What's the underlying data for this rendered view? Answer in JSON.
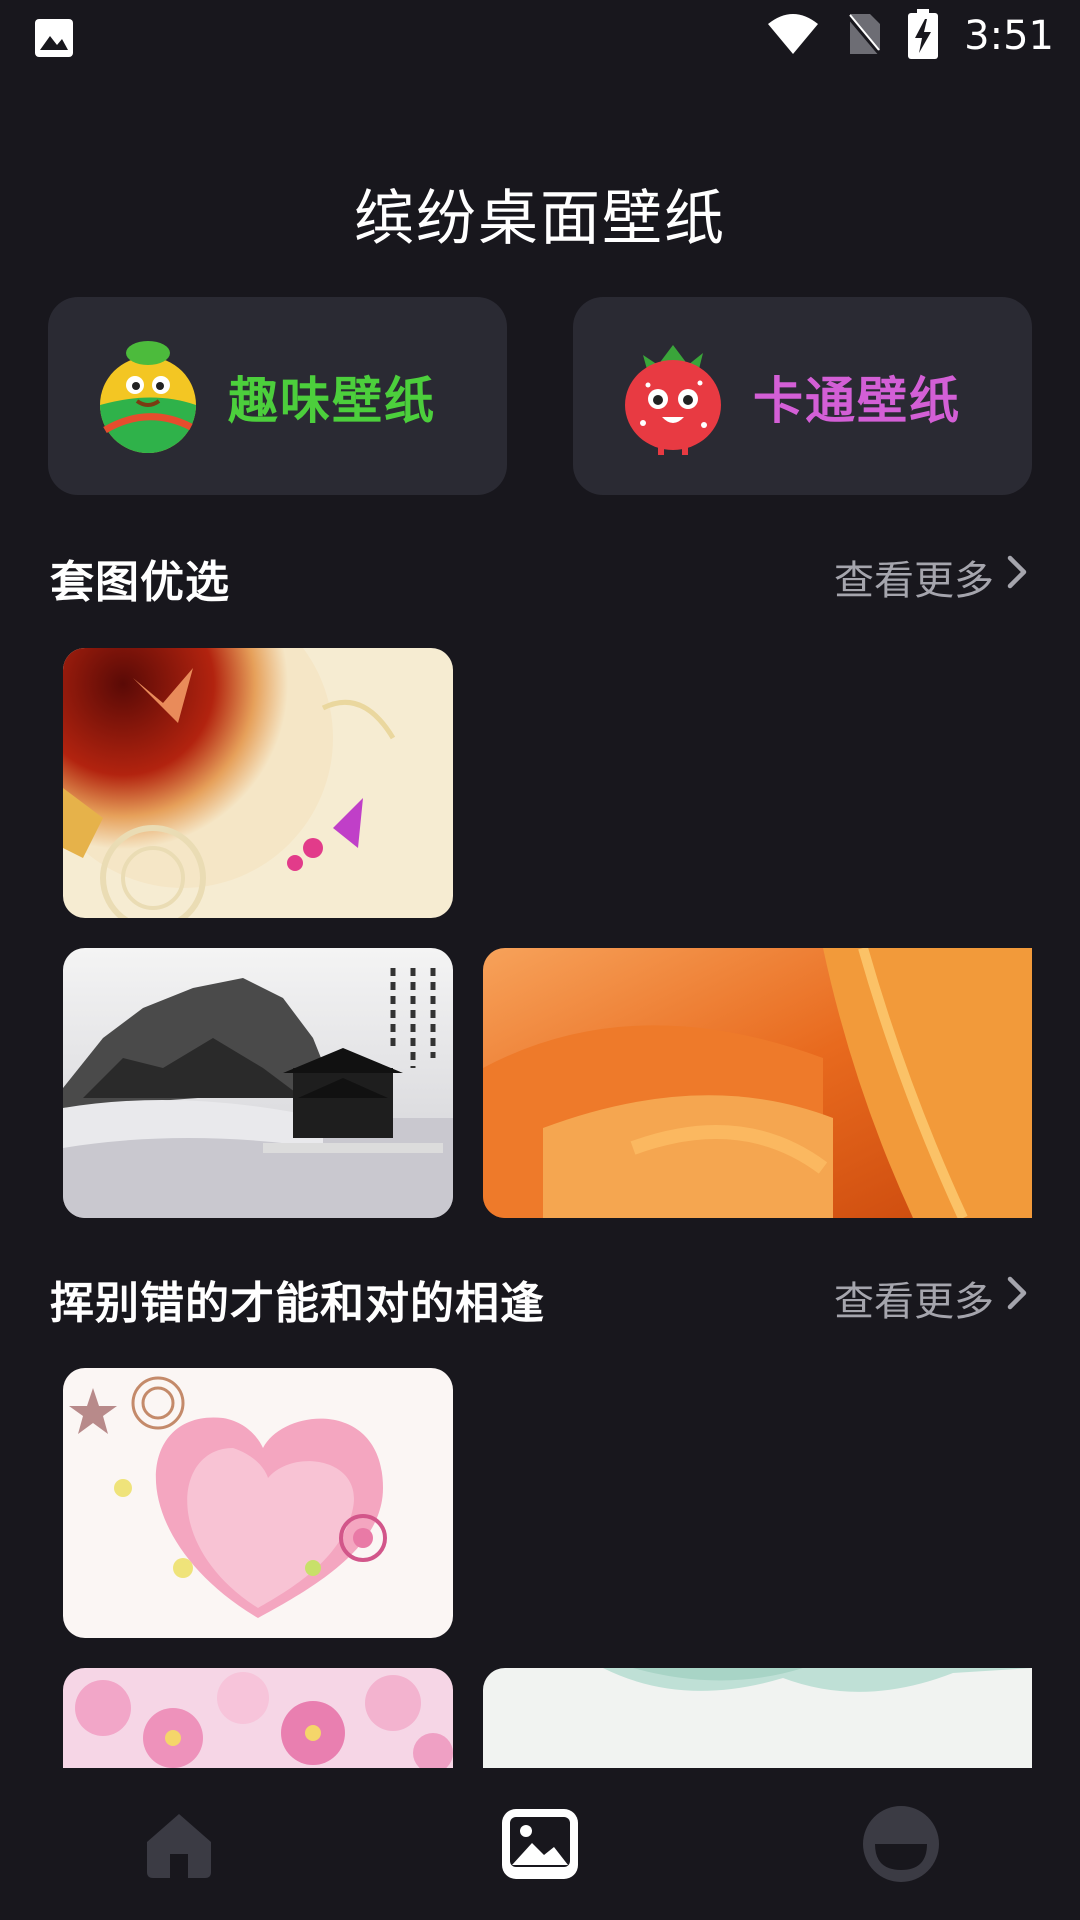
{
  "status_bar": {
    "time": "3:51",
    "icons": [
      "gallery-notification-icon",
      "wifi-icon",
      "no-sim-icon",
      "battery-charging-icon"
    ]
  },
  "header": {
    "title": "缤纷桌面壁纸"
  },
  "categories": [
    {
      "label": "趣味壁纸",
      "color": "#4ccf3c",
      "mascot": "green-ball-mascot-icon"
    },
    {
      "label": "卡通壁纸",
      "color": "#d35fd6",
      "mascot": "strawberry-mascot-icon"
    }
  ],
  "sections": [
    {
      "title": "套图优选",
      "more": "查看更多"
    },
    {
      "title": "挥别错的才能和对的相逢",
      "more": "查看更多"
    }
  ],
  "bottom_nav": {
    "items": [
      "home-icon",
      "wallpaper-icon",
      "profile-icon"
    ],
    "active": "wallpaper-icon"
  },
  "colors": {
    "background": "#18171d",
    "card": "#2a2a33",
    "muted_text": "#a5a5ad"
  }
}
